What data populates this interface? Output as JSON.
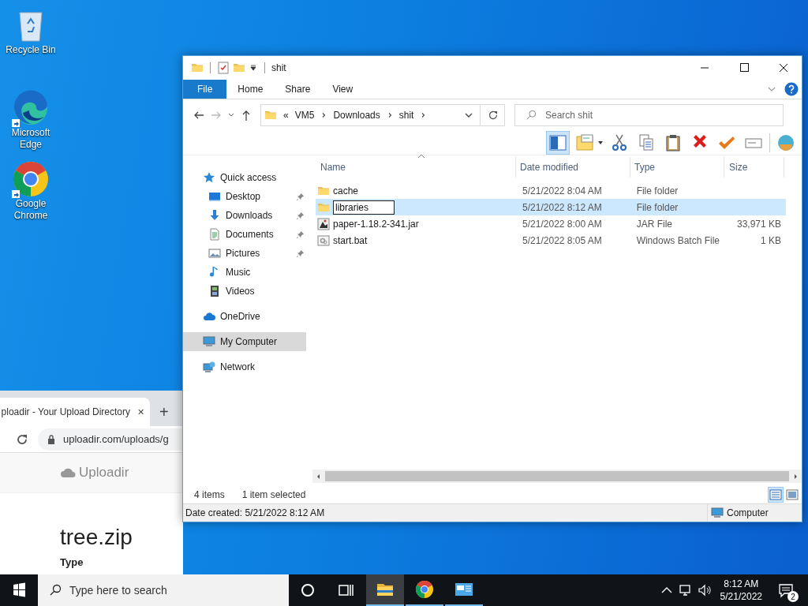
{
  "desktop_icons": [
    {
      "label": "Recycle Bin",
      "kind": "recycle",
      "shortcut": false
    },
    {
      "label": "Microsoft Edge",
      "kind": "edge",
      "shortcut": true
    },
    {
      "label": "Google Chrome",
      "kind": "chrome",
      "shortcut": true
    }
  ],
  "browser": {
    "tab_title": "ploadir - Your Upload Directory",
    "tab_close": "✕",
    "new_tab": "+",
    "url": "uploadir.com/uploads/g",
    "site_name": "Uploadir",
    "file_title": "tree.zip",
    "section_label": "Type"
  },
  "explorer": {
    "title": "shit",
    "ribbon_tabs": [
      {
        "label": "File",
        "selected": true
      },
      {
        "label": "Home",
        "selected": false
      },
      {
        "label": "Share",
        "selected": false
      },
      {
        "label": "View",
        "selected": false
      }
    ],
    "overflow_marker": "«",
    "breadcrumb": [
      "VM5",
      "Downloads",
      "shit"
    ],
    "search": {
      "placeholder": "Search shit"
    },
    "toolbar_buttons": [
      {
        "kind": "pane",
        "selected": true
      },
      {
        "kind": "properties",
        "selected": false
      },
      {
        "kind": "cut",
        "selected": false
      },
      {
        "kind": "copy",
        "selected": false
      },
      {
        "kind": "paste",
        "selected": false
      },
      {
        "kind": "delete",
        "selected": false
      },
      {
        "kind": "check",
        "selected": false
      },
      {
        "kind": "rename",
        "selected": false
      },
      {
        "kind": "shell",
        "selected": false
      }
    ],
    "nav_pane": [
      {
        "label": "Quick access",
        "kind": "star",
        "pinned": false,
        "selected": false,
        "children": [
          {
            "label": "Desktop",
            "kind": "desktop",
            "pinned": true,
            "selected": false
          },
          {
            "label": "Downloads",
            "kind": "downloads",
            "pinned": true,
            "selected": false
          },
          {
            "label": "Documents",
            "kind": "documents",
            "pinned": true,
            "selected": false
          },
          {
            "label": "Pictures",
            "kind": "pictures",
            "pinned": true,
            "selected": false
          },
          {
            "label": "Music",
            "kind": "music",
            "pinned": false,
            "selected": false
          },
          {
            "label": "Videos",
            "kind": "videos",
            "pinned": false,
            "selected": false
          }
        ]
      },
      {
        "label": "OneDrive",
        "kind": "onedrive",
        "pinned": false,
        "selected": false
      },
      {
        "label": "My Computer",
        "kind": "computer",
        "pinned": false,
        "selected": true
      },
      {
        "label": "Network",
        "kind": "network",
        "pinned": false,
        "selected": false
      }
    ],
    "columns": [
      "Name",
      "Date modified",
      "Type",
      "Size"
    ],
    "rows": [
      {
        "name": "cache",
        "kind": "folder",
        "date_modified": "5/21/2022 8:04 AM",
        "type": "File folder",
        "size": "",
        "selected": false,
        "editing": false
      },
      {
        "name": "libraries",
        "kind": "folder",
        "date_modified": "5/21/2022 8:12 AM",
        "type": "File folder",
        "size": "",
        "selected": true,
        "editing": true
      },
      {
        "name": "paper-1.18.2-341.jar",
        "kind": "jar",
        "date_modified": "5/21/2022 8:00 AM",
        "type": "JAR File",
        "size": "33,971 KB",
        "selected": false,
        "editing": false
      },
      {
        "name": "start.bat",
        "kind": "bat",
        "date_modified": "5/21/2022 8:05 AM",
        "type": "Windows Batch File",
        "size": "1 KB",
        "selected": false,
        "editing": false
      }
    ],
    "status": {
      "item_count": "4 items",
      "selection": "1 item selected"
    },
    "view_buttons": [
      {
        "kind": "details",
        "selected": true
      },
      {
        "kind": "tiles",
        "selected": false
      }
    ],
    "details_bar": {
      "text": "Date created: 5/21/2022 8:12 AM",
      "location": "Computer"
    }
  },
  "taskbar": {
    "search_placeholder": "Type here to search",
    "apps": [
      {
        "kind": "explorer",
        "active": true
      },
      {
        "kind": "chrome",
        "active": false
      },
      {
        "kind": "app",
        "active": false
      }
    ],
    "time": "8:12 AM",
    "date": "5/21/2022",
    "notification_count": "2"
  }
}
